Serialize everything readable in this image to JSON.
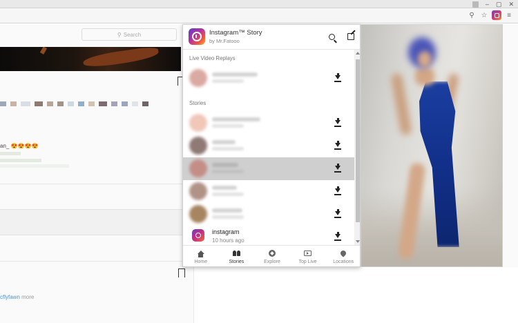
{
  "page": {
    "search_placeholder": "Search",
    "comment_user": "an_",
    "comment_emoji": "😍😍😍😍",
    "more_user": "cflyfawn",
    "more_text": "more"
  },
  "popup": {
    "title": "Instagram™ Story",
    "subtitle": "by Mr.Fatooo",
    "sections": {
      "live": "Live Video Replays",
      "stories": "Stories"
    },
    "instagram_row": {
      "name": "instagram",
      "time": "10 hours ago"
    },
    "nav": [
      {
        "label": "Home",
        "icon": "home-icon"
      },
      {
        "label": "Stories",
        "icon": "people-icon"
      },
      {
        "label": "Explore",
        "icon": "compass-icon"
      },
      {
        "label": "Top Live",
        "icon": "tv-icon"
      },
      {
        "label": "Locations",
        "icon": "location-pin-icon"
      }
    ]
  }
}
